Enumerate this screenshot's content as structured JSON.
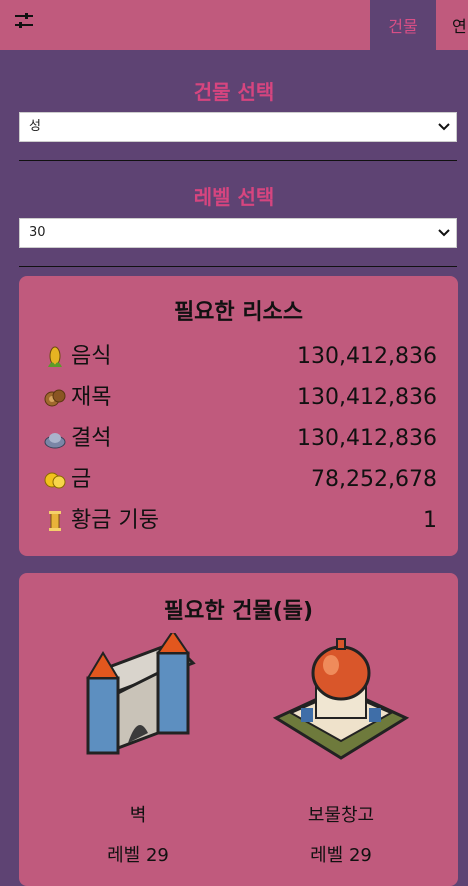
{
  "header": {
    "menu_icon": "sliders-icon",
    "active_tab": "건물",
    "next_tab": "연"
  },
  "building_select": {
    "title": "건물 선택",
    "value": "성"
  },
  "level_select": {
    "title": "레벨 선택",
    "value": "30"
  },
  "resources": {
    "title": "필요한 리소스",
    "items": [
      {
        "label": "음식",
        "value": "130,412,836",
        "icon": "corn-icon"
      },
      {
        "label": "재목",
        "value": "130,412,836",
        "icon": "wood-icon"
      },
      {
        "label": "결석",
        "value": "130,412,836",
        "icon": "stone-icon"
      },
      {
        "label": "금",
        "value": "78,252,678",
        "icon": "gold-icon"
      },
      {
        "label": "황금 기둥",
        "value": "1",
        "icon": "golden-pillar-icon"
      }
    ]
  },
  "buildings": {
    "title": "필요한 건물(들)",
    "items": [
      {
        "name": "벽",
        "level": "레벨 29",
        "icon": "wall-icon"
      },
      {
        "name": "보물창고",
        "level": "레벨 29",
        "icon": "treasury-icon"
      }
    ]
  },
  "colors": {
    "background": "#5e4373",
    "panel": "#c05a7d",
    "accent": "#d6457f"
  }
}
